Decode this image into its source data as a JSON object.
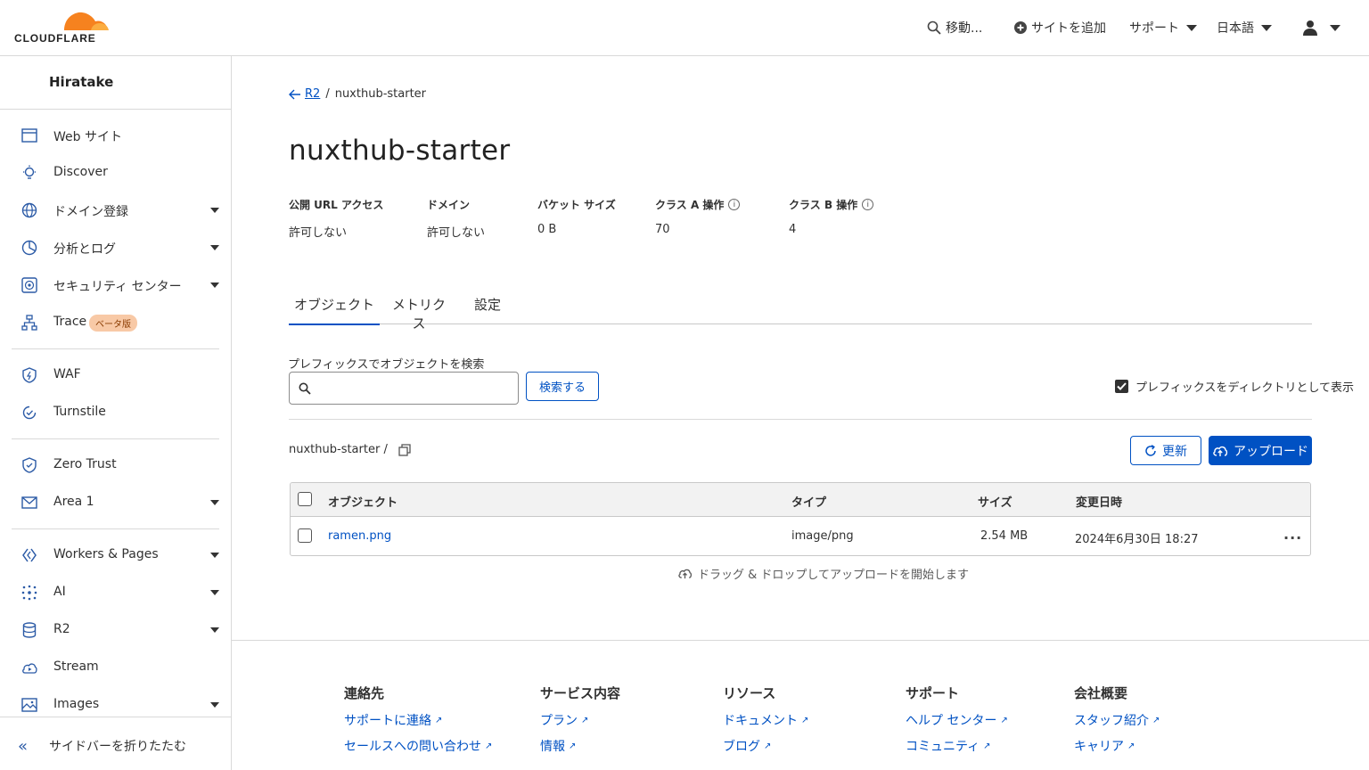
{
  "header": {
    "logo_text": "CLOUDFLARE",
    "search_label": "移動...",
    "add_site_label": "サイトを追加",
    "support_label": "サポート",
    "language_label": "日本語"
  },
  "sidebar": {
    "account_name": "Hiratake",
    "items": [
      {
        "label": "Web サイト"
      },
      {
        "label": "Discover"
      },
      {
        "label": "ドメイン登録"
      },
      {
        "label": "分析とログ"
      },
      {
        "label": "セキュリティ センター"
      },
      {
        "label": "Trace",
        "badge": "ベータ版"
      },
      {
        "label": "WAF"
      },
      {
        "label": "Turnstile"
      },
      {
        "label": "Zero Trust"
      },
      {
        "label": "Area 1"
      },
      {
        "label": "Workers & Pages"
      },
      {
        "label": "AI"
      },
      {
        "label": "R2"
      },
      {
        "label": "Stream"
      },
      {
        "label": "Images"
      }
    ],
    "collapse_label": "サイドバーを折りたたむ"
  },
  "breadcrumb": {
    "back_label": "R2",
    "separator": "/",
    "current": "nuxthub-starter"
  },
  "page_title": "nuxthub-starter",
  "stats": [
    {
      "label": "公開 URL アクセス",
      "value": "許可しない"
    },
    {
      "label": "ドメイン",
      "value": "許可しない"
    },
    {
      "label": "バケット サイズ",
      "value": "0 B"
    },
    {
      "label": "クラス A 操作",
      "value": "70"
    },
    {
      "label": "クラス B 操作",
      "value": "4"
    }
  ],
  "tabs": [
    {
      "label": "オブジェクト",
      "active": true
    },
    {
      "label": "メトリクス",
      "active": false
    },
    {
      "label": "設定",
      "active": false
    }
  ],
  "search": {
    "label": "プレフィックスでオブジェクトを検索",
    "placeholder": "",
    "value": "",
    "button_label": "検索する"
  },
  "prefix_checkbox": {
    "label": "プレフィックスをディレクトリとして表示",
    "checked": true
  },
  "path": "nuxthub-starter /",
  "refresh_label": "更新",
  "upload_label": "アップロード",
  "table": {
    "columns": [
      "オブジェクト",
      "タイプ",
      "サイズ",
      "変更日時"
    ],
    "rows": [
      {
        "name": "ramen.png",
        "type": "image/png",
        "size": "2.54 MB",
        "modified": "2024年6月30日 18:27"
      }
    ]
  },
  "drop_hint": "ドラッグ & ドロップしてアップロードを開始します",
  "footer": {
    "columns": [
      {
        "heading": "連絡先",
        "links": [
          "サポートに連絡",
          "セールスへの問い合わせ"
        ]
      },
      {
        "heading": "サービス内容",
        "links": [
          "プラン",
          "情報"
        ]
      },
      {
        "heading": "リソース",
        "links": [
          "ドキュメント",
          "ブログ"
        ]
      },
      {
        "heading": "サポート",
        "links": [
          "ヘルプ センター",
          "コミュニティ"
        ]
      },
      {
        "heading": "会社概要",
        "links": [
          "スタッフ紹介",
          "キャリア"
        ]
      }
    ]
  },
  "colors": {
    "brand_orange": "#f6821f",
    "link_blue": "#0051c3"
  }
}
